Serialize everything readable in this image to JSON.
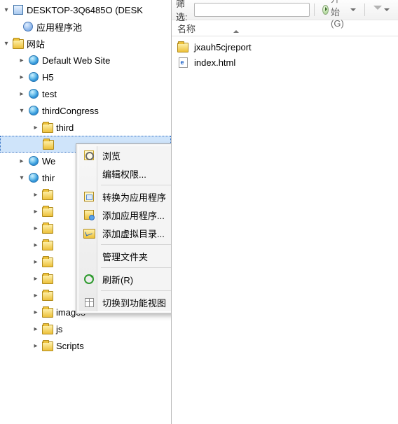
{
  "tree": {
    "root": "DESKTOP-3Q6485O (DESK",
    "apppool": "应用程序池",
    "sites": "网站",
    "default_site": "Default Web Site",
    "h5": "H5",
    "test": "test",
    "thirdcongress": "thirdCongress",
    "third": "third",
    "we": "We",
    "thir": "thir",
    "images": "images",
    "js": "js",
    "scripts": "Scripts"
  },
  "toolbar": {
    "filter_label": "筛选:",
    "go_label": "开始(G)"
  },
  "list": {
    "header": "名称",
    "items": [
      {
        "name": "jxauh5cjreport",
        "type": "folder"
      },
      {
        "name": "index.html",
        "type": "html"
      }
    ]
  },
  "ctx": {
    "browse": "浏览",
    "edit_perm": "编辑权限...",
    "convert": "转换为应用程序",
    "add_app": "添加应用程序...",
    "add_vdir": "添加虚拟目录...",
    "manage_folder": "管理文件夹",
    "refresh": "刷新(R)",
    "switch_view": "切换到功能视图"
  }
}
